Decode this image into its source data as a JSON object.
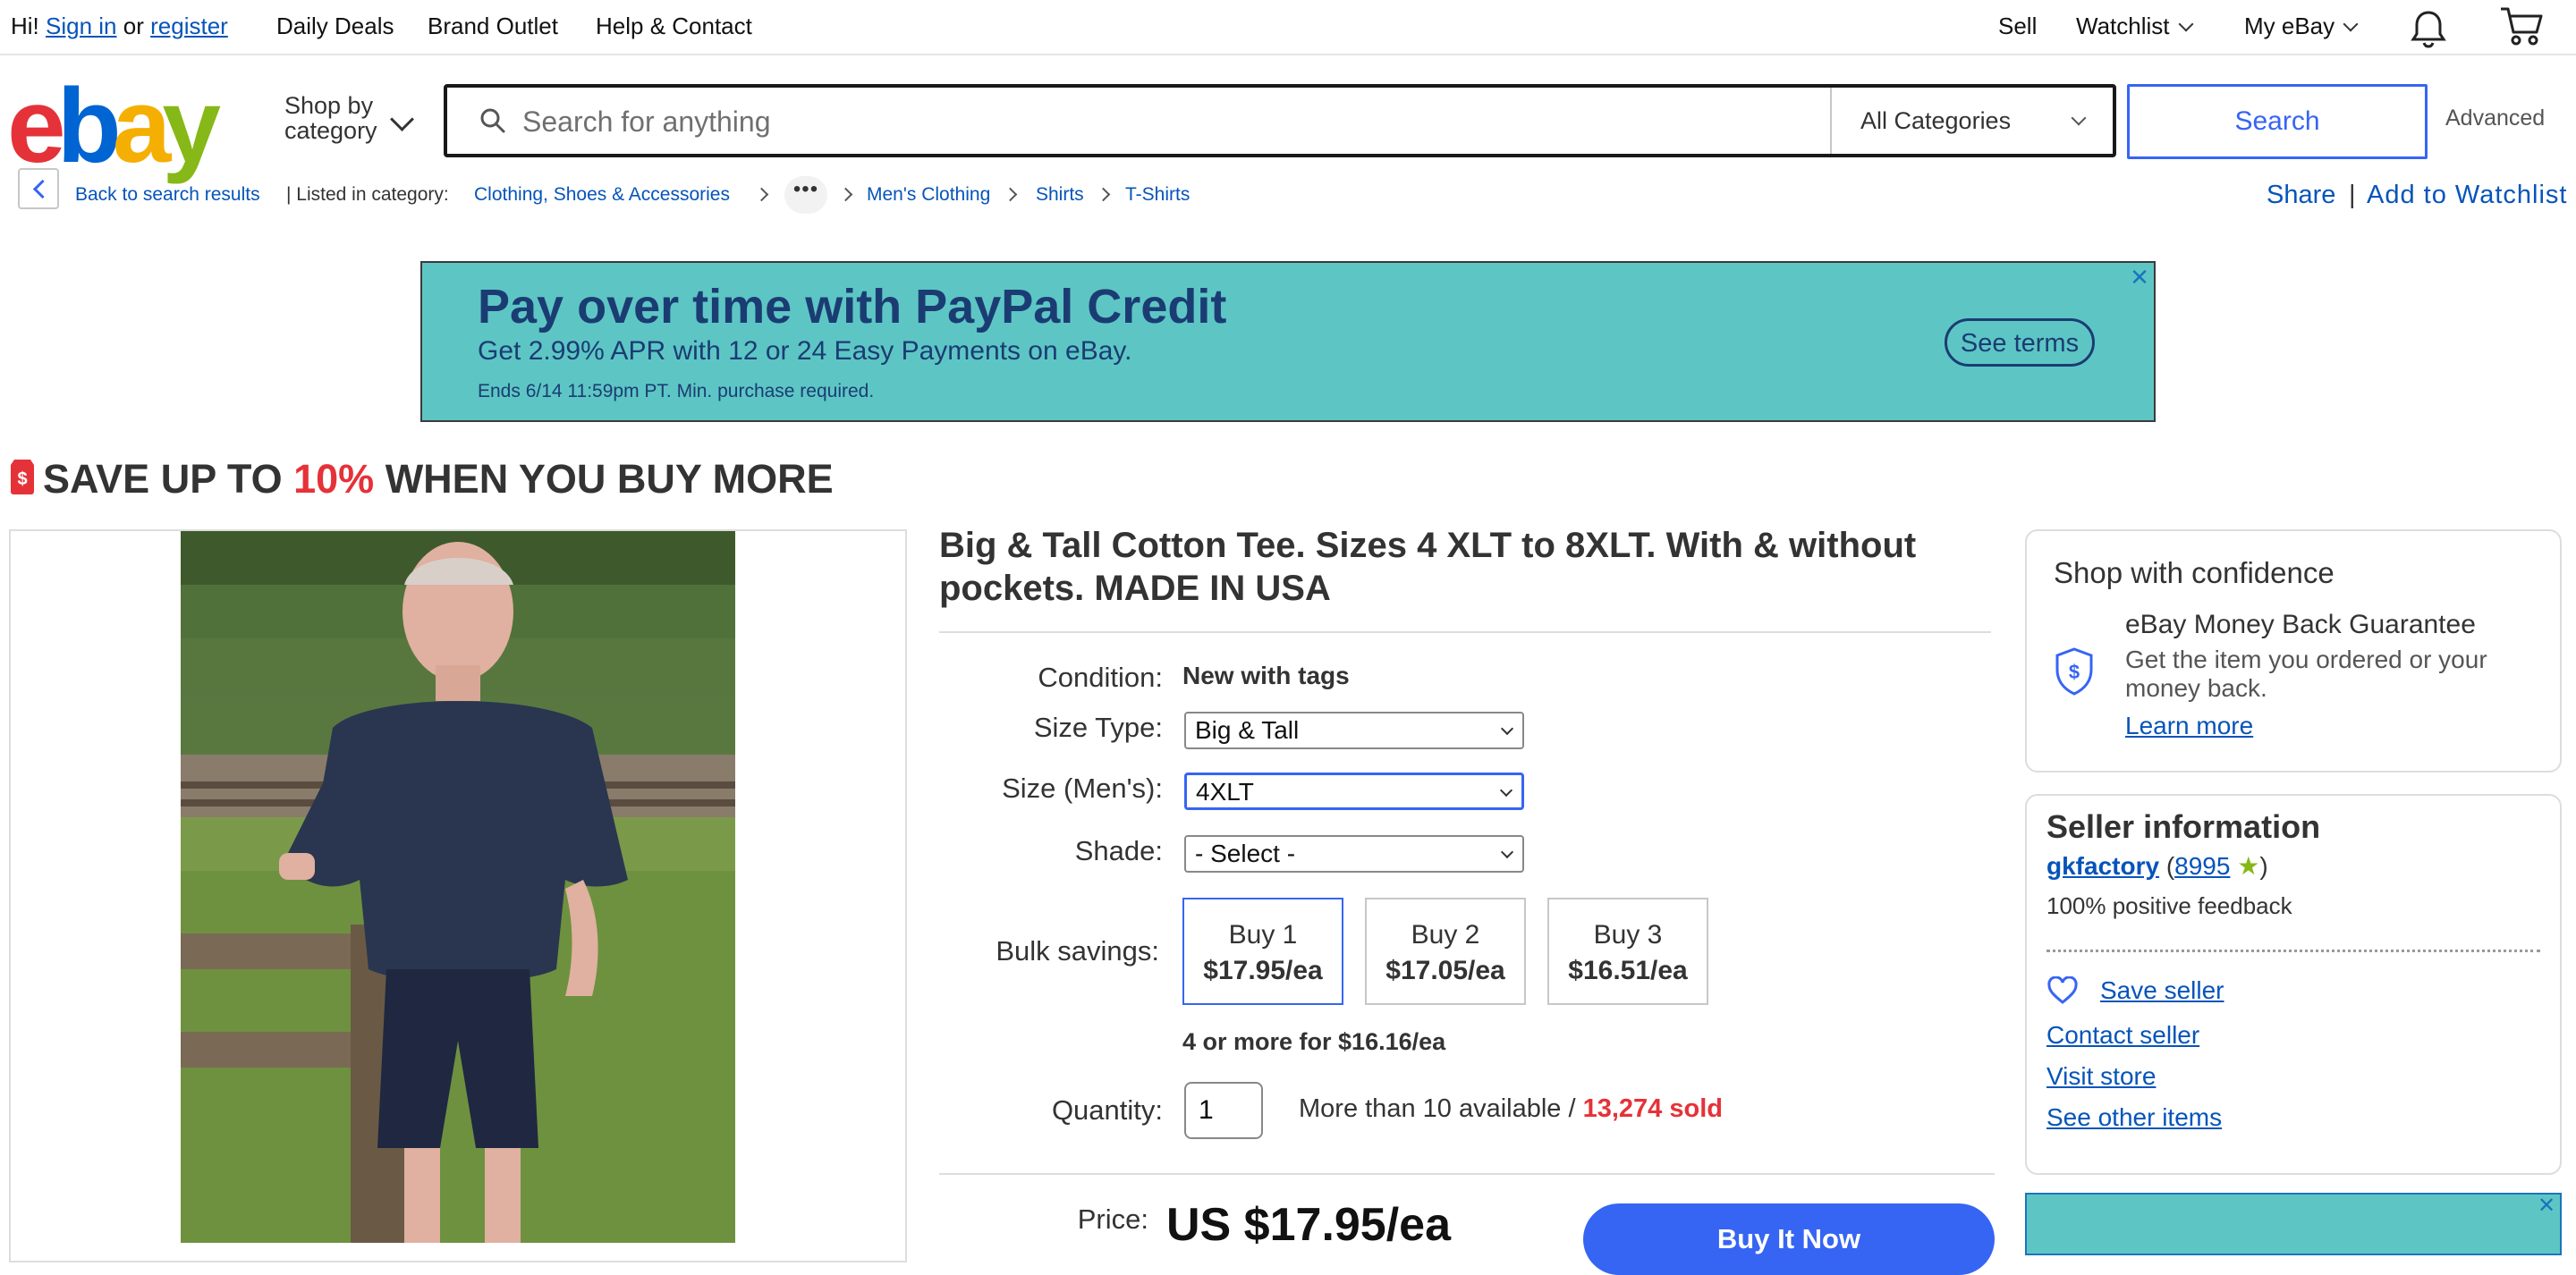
{
  "topbar": {
    "greeting": "Hi!",
    "sign_in": "Sign in",
    "or": "or",
    "register": "register",
    "daily_deals": "Daily Deals",
    "brand_outlet": "Brand Outlet",
    "help_contact": "Help & Contact",
    "sell": "Sell",
    "watchlist": "Watchlist",
    "my_ebay": "My eBay"
  },
  "header": {
    "logo": {
      "e": "e",
      "b": "b",
      "a": "a",
      "y": "y"
    },
    "shop_by_line1": "Shop by",
    "shop_by_line2": "category",
    "search_placeholder": "Search for anything",
    "category_value": "All Categories",
    "search_button": "Search",
    "advanced": "Advanced"
  },
  "breadcrumb": {
    "back": "Back to search results",
    "listed_in": "| Listed in category:",
    "items": [
      "Clothing, Shoes & Accessories",
      "Men's Clothing",
      "Shirts",
      "T-Shirts"
    ],
    "more": "•••",
    "share": "Share",
    "separator": "|",
    "add_to_watchlist": "Add to Watchlist"
  },
  "banner": {
    "title": "Pay over time with PayPal Credit",
    "subtitle": "Get 2.99% APR with 12 or 24 Easy Payments on eBay.",
    "fine_print": "Ends 6/14 11:59pm PT. Min. purchase required.",
    "terms": "See terms",
    "close": "✕"
  },
  "promo": {
    "prefix": "SAVE UP TO",
    "percent": "10%",
    "suffix": "WHEN YOU BUY MORE"
  },
  "item": {
    "title": "Big & Tall Cotton Tee. Sizes 4 XLT to 8XLT. With & without pockets. MADE IN USA",
    "condition_label": "Condition:",
    "condition_value": "New with tags",
    "size_type_label": "Size Type:",
    "size_type_value": "Big & Tall",
    "size_mens_label": "Size (Men's):",
    "size_mens_value": "4XLT",
    "shade_label": "Shade:",
    "shade_value": "- Select -",
    "bulk_label": "Bulk savings:",
    "bulk_options": [
      {
        "qty": "Buy 1",
        "price": "$17.95/ea"
      },
      {
        "qty": "Buy 2",
        "price": "$17.05/ea"
      },
      {
        "qty": "Buy 3",
        "price": "$16.51/ea"
      }
    ],
    "bulk_more": "4 or more for $16.16/ea",
    "quantity_label": "Quantity:",
    "quantity_value": "1",
    "available": "More than 10 available /",
    "sold": "13,274 sold",
    "price_label": "Price:",
    "price_value": "US $17.95/ea",
    "buy_now": "Buy It Now"
  },
  "confidence": {
    "heading": "Shop with confidence",
    "guarantee_title": "eBay Money Back Guarantee",
    "guarantee_text": "Get the item you ordered or your money back.",
    "learn_more": "Learn more"
  },
  "seller": {
    "heading": "Seller information",
    "name": "gkfactory",
    "open_paren": "(",
    "feedback_score": "8995",
    "close_paren": ")",
    "positive": "100% positive feedback",
    "save_seller": "Save seller",
    "contact": "Contact seller",
    "visit_store": "Visit store",
    "other_items": "See other items"
  },
  "colors": {
    "link_blue": "#3665f3",
    "dark_link": "#0654ba",
    "sale_red": "#e53238",
    "banner_teal": "#5dc6c4",
    "banner_navy": "#1b3c73"
  }
}
